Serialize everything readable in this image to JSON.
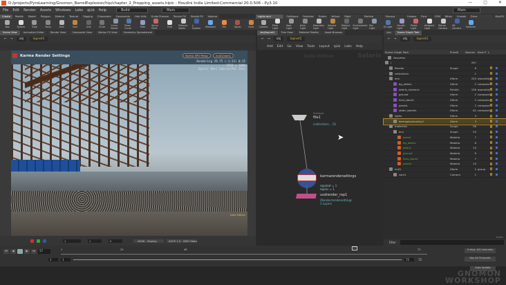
{
  "window": {
    "title": "D:/projects/PyroLearning/Gnomon_BarrelExplosion/hip/chapter_2_Prepping_assets.hiplc - Houdini Indie Limited-Commercial 20.0.506 - Py3.10",
    "minimize": "—",
    "maximize": "▢",
    "close": "✕"
  },
  "menu": {
    "items": [
      "File",
      "Edit",
      "Render",
      "Assets",
      "Windows",
      "Labs",
      "qLib",
      "Help"
    ],
    "desktop1": "Build",
    "desktop2": "Main",
    "desktop3": "Main"
  },
  "shelf_left": {
    "tabs": [
      "Create",
      "Modify",
      "Model",
      "Polygon",
      "Deform",
      "Texture",
      "Rigging",
      "Characters",
      "Constraints",
      "Hair Utils",
      "Guide Process",
      "Terrain FX",
      "Simple FX",
      "Volume"
    ],
    "tools": [
      "Box",
      "Sphere",
      "Tube",
      "Torus",
      "Grid",
      "Null",
      "Line",
      "Circle",
      "Curve Bezier",
      "Draw Curve",
      "Path",
      "Spray Paint",
      "Font",
      "Platonic Solids",
      "L-System",
      "Metaball",
      "File",
      "Spiral",
      "Helix"
    ]
  },
  "shelf_right": {
    "tabs": [
      "Lights and Cameras",
      "Collisions",
      "Particles",
      "Grains",
      "Vellum",
      "Rigid Bodies",
      "Particle Fluids",
      "Viscous Fluids",
      "Oceans",
      "Pyro FX",
      "FEM",
      "Wires",
      "Crowds",
      "Drive Simulation",
      "KineFX"
    ],
    "tools": [
      "Camera",
      "Point Light",
      "Spot Light",
      "Area Light",
      "Geometry Light",
      "Volume Light",
      "Distant Light",
      "Environment Light",
      "Sky Light",
      "GI Light",
      "Caustic Light",
      "Portal Light",
      "Ambient Light",
      "Stereo Camera",
      "VR Camera",
      "Switcher"
    ]
  },
  "left_pane": {
    "tabs": [
      "Scene View",
      "Animation Editor",
      "Render View",
      "Composite View",
      "Motion FX View",
      "Geometry Spreadsheet"
    ],
    "path": [
      "obj",
      "lopnet1"
    ]
  },
  "viewport": {
    "title": "Karma Render Settings",
    "renderer": "Karma XPU Persp",
    "camera": "/null1/cam1",
    "status_line1": "Rendering  29.75  (-1:23)  0:35",
    "status_line2": "1920 x 1080",
    "status_line3": "Optix[ 84%] EmbreeCPU[ 16%]",
    "edition": "Indie Edition"
  },
  "viewport_bottom": {
    "field1": "1",
    "field2": "1",
    "field3": "0",
    "display": "sRGB - Display",
    "view": "ACES 1.0 - SDR Video"
  },
  "net_pane": {
    "tabs": [
      "/obj/lopnet1",
      "Tree View",
      "Material Palette",
      "Asset Browser"
    ],
    "path": [
      "obj",
      "lopnet1"
    ],
    "menu": [
      "Add",
      "Edit",
      "Go",
      "View",
      "Tools",
      "Layout",
      "qLib",
      "Labs",
      "Help"
    ],
    "watermark1": "Indie Edition",
    "watermark2": "Solaris",
    "nodes": [
      {
        "type": "Sublayer",
        "name": "file1",
        "info": "/collections... (5)"
      },
      {
        "name": "karmarendersettings",
        "info1": "ropstart = 1",
        "info2": "ropinc = 1"
      },
      {
        "name": "usdrender_rop1",
        "info1": "/Render/rendersettings",
        "info2": "3 Layers"
      }
    ]
  },
  "scene_graph": {
    "tabs": [
      "/obj",
      "Scene Graph Tree"
    ],
    "path": [
      "obj",
      "lopnet1"
    ],
    "columns": [
      "Scene Graph Path",
      "Primiti",
      "Descen",
      "Kind",
      "P",
      "L"
    ],
    "rows": [
      {
        "name": "Favorites",
        "type": "",
        "desc": "",
        "kind": ""
      },
      {
        "name": "/",
        "type": "",
        "desc": "297",
        "kind": ""
      },
      {
        "name": "Render",
        "type": "Scope",
        "desc": "6",
        "kind": ""
      },
      {
        "name": "collections",
        "type": "",
        "desc": "1",
        "kind": ""
      },
      {
        "name": "env",
        "type": "Xform",
        "desc": "220",
        "kind": "assembly"
      },
      {
        "name": "bg_debris",
        "type": "Xform",
        "desc": "2",
        "kind": "compone"
      },
      {
        "name": "debris_instance",
        "type": "PointIn",
        "desc": "156",
        "kind": "assembly"
      },
      {
        "name": "ground",
        "type": "Xform",
        "desc": "2",
        "kind": "compone"
      },
      {
        "name": "hero_barrel",
        "type": "Xform",
        "desc": "3",
        "kind": "compone"
      },
      {
        "name": "panels",
        "type": "Xform",
        "desc": "2",
        "kind": "compone"
      },
      {
        "name": "static_barrels",
        "type": "Xform",
        "desc": "62",
        "kind": "compone"
      },
      {
        "name": "lights",
        "type": "Xform",
        "desc": "4",
        "kind": ""
      },
      {
        "name": "karmaphysicalsky1",
        "type": "Xform",
        "desc": "3",
        "kind": ""
      },
      {
        "name": "materials",
        "type": "Scope",
        "desc": "56",
        "kind": ""
      },
      {
        "name": "env",
        "type": "Scope",
        "desc": "55",
        "kind": ""
      },
      {
        "name": "barrel",
        "type": "Materia",
        "desc": "7",
        "kind": ""
      },
      {
        "name": "bg_debris",
        "type": "Materia",
        "desc": "6",
        "kind": ""
      },
      {
        "name": "debris",
        "type": "Materia",
        "desc": "10",
        "kind": ""
      },
      {
        "name": "ground",
        "type": "Materia",
        "desc": "9",
        "kind": ""
      },
      {
        "name": "hero_barrel",
        "type": "Materia",
        "desc": "7",
        "kind": ""
      },
      {
        "name": "panels",
        "type": "Materia",
        "desc": "15",
        "kind": ""
      },
      {
        "name": "null1",
        "type": "Xform",
        "desc": "2",
        "kind": "group"
      },
      {
        "name": "cam1",
        "type": "Camera",
        "desc": "1",
        "kind": ""
      }
    ],
    "filter_label": "Filter",
    "index_label": "Index"
  },
  "timeline": {
    "current_frame": "57",
    "marker": "57",
    "start": "1",
    "start2": "1",
    "end": "72",
    "end2": "72",
    "ticks": [
      "1",
      "24",
      "48",
      "72"
    ],
    "keys": "0 keys, 0/0 channels",
    "key_all": "Key All Channels",
    "auto_update": "Auto Update"
  },
  "colors": {
    "accent": "#d4a82a",
    "selection": "#b88d2d",
    "node_blue": "#3a5db0",
    "node_pink": "#c0508a"
  },
  "watermark": "GNOMON WORKSHOP"
}
